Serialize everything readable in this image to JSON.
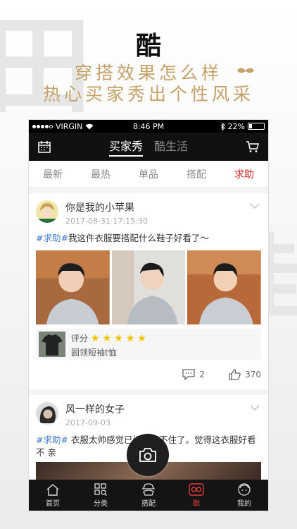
{
  "header": {
    "title": "酷",
    "slogan_line1": "穿搭效果怎么样",
    "slogan_line2": "热心买家秀出个性风采"
  },
  "status_bar": {
    "carrier": "VIRGIN",
    "time": "8:46 PM",
    "battery": "22%"
  },
  "app_bar": {
    "tabs": [
      "买家秀",
      "酷生活"
    ],
    "active_tab": "买家秀"
  },
  "sub_nav": {
    "items": [
      "最新",
      "最热",
      "单品",
      "搭配",
      "求助"
    ],
    "active": "求助"
  },
  "posts": [
    {
      "username": "你是我的小苹果",
      "date": "2017-08-31 17:15:30",
      "tag": "#求助#",
      "text": "我这件衣服要搭配什么鞋子好看了～",
      "product": {
        "rating_label": "评分",
        "stars": 5,
        "name": "圆领短袖t恤"
      },
      "comments": "2",
      "likes": "370"
    },
    {
      "username": "风一样的女子",
      "date": "2017-09-03",
      "tag": "#求助#",
      "text": "衣服太帅感觉已经驾驭不住了。觉得这衣服好看 不 亲"
    }
  ],
  "bottom_nav": {
    "items": [
      "首页",
      "分类",
      "搭配",
      "酷",
      "我的"
    ],
    "active": "酷"
  },
  "colors": {
    "accent_red": "#cc1f1f",
    "gold": "#c4a167",
    "tag_blue": "#3b79c9",
    "star": "#f6c300"
  }
}
